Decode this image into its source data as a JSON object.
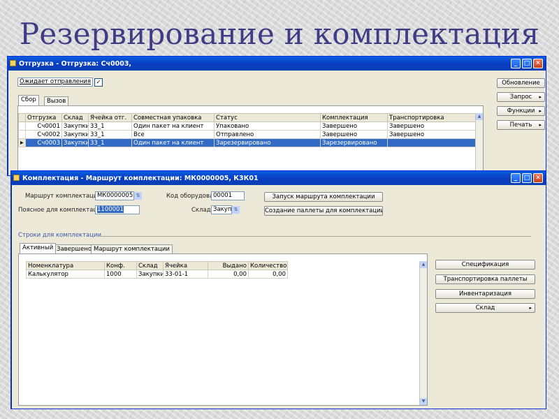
{
  "slide": {
    "title": "Резервирование и комплектация"
  },
  "shipment_window": {
    "title": "Отгрузка - Отгрузка: Сч0003,",
    "status_select": "Ожидает отправления",
    "tabs": [
      "Сбор",
      "Вызов"
    ],
    "columns": [
      "Отгрузка",
      "Склад",
      "Ячейка отг.",
      "Совместная упаковка",
      "Статус",
      "Комплектация",
      "Транспортировка"
    ],
    "rows": [
      [
        "Сч0001",
        "Закупки",
        "33_1",
        "Один пакет на клиент",
        "Упаковано",
        "Завершено",
        "Завершено"
      ],
      [
        "Сч0002",
        "Закупки",
        "33_1",
        "Все",
        "Отправлено",
        "Завершено",
        "Завершено"
      ],
      [
        "Сч0003",
        "Закупки",
        "33_1",
        "Один пакет на клиент",
        "Зарезервировано",
        "Зарезервировано",
        ""
      ]
    ],
    "side_buttons": [
      "Обновление",
      "Запрос",
      "Функции",
      "Печать"
    ]
  },
  "picking_window": {
    "title": "Комплектация - Маршрут комплектации: МК0000005, К3К01",
    "route_label": "Маршрут комплектации:",
    "route_value": "МК0000005",
    "zone_label": "Код оборудования:",
    "zone_value": "00001",
    "zone2_label": "Поясное для комплектации:",
    "zone2_value": "1100001",
    "warehouse_label": "Склад:",
    "warehouse_value": "Закупки",
    "btn_start": "Запуск маршрута комплектации",
    "btn_create": "Создание паллеты для комплектации",
    "section_label": "Строки для комплектации",
    "tabs": [
      "Активный",
      "Завершено",
      "Маршрут комплектации"
    ],
    "columns": [
      "Номенклатура",
      "Конф.",
      "Склад",
      "Ячейка",
      "Выдано",
      "Количество"
    ],
    "rows": [
      [
        "Калькулятор",
        "1000",
        "Закупки",
        "33-01-1",
        "0,00",
        "0,00"
      ]
    ],
    "side_buttons": [
      "Спецификация",
      "Транспортировка паллеты",
      "Инвентаризация",
      "Склад"
    ]
  }
}
